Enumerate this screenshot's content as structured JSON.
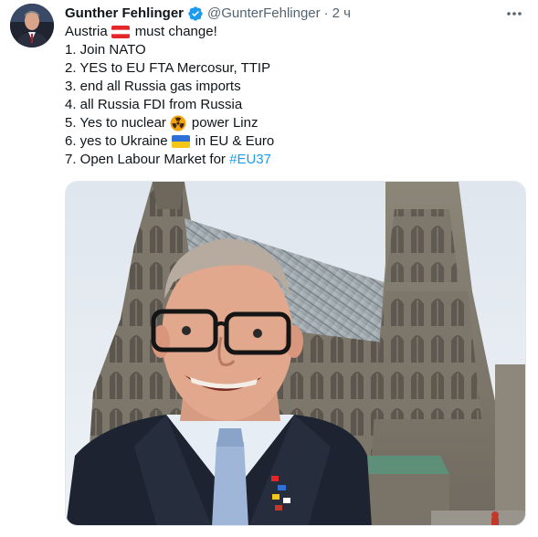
{
  "author": {
    "display_name": "Gunther Fehlinger",
    "handle": "@GunterFehlinger",
    "separator": "·",
    "time": "2 ч",
    "verified_icon": "verified-badge-icon"
  },
  "tweet": {
    "line1_before": "Austria",
    "line1_after": "must change!",
    "items": [
      "1. Join NATO",
      "2. YES to EU FTA Mercosur, TTIP",
      "3. end all Russia gas imports",
      "4. all Russia FDI from Russia"
    ],
    "item5_before": "5. Yes to nuclear",
    "item5_after": "power Linz",
    "item6_before": "6. yes to Ukraine",
    "item6_after": "in EU & Euro",
    "item7_before": "7. Open Labour Market for",
    "hashtag": "#EU37"
  },
  "icons": {
    "austria_flag": "austria-flag-icon",
    "radioactive": "radioactive-icon",
    "ukraine_flag": "ukraine-flag-icon",
    "more": "more-options-icon"
  },
  "colors": {
    "link": "#1d9bf0",
    "verified": "#1d9bf0",
    "secondary_text": "#536471",
    "austria_red": "#e4262b",
    "ukraine_blue": "#2f6fd6",
    "ukraine_yellow": "#f5c518"
  }
}
